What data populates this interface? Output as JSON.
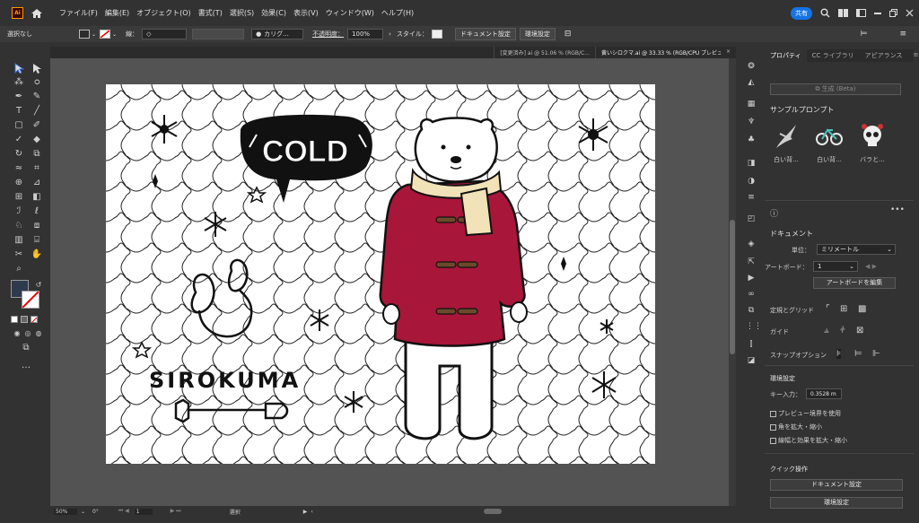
{
  "menubar": {
    "logo": "Ai",
    "items": [
      "ファイル(F)",
      "編集(E)",
      "オブジェクト(O)",
      "書式(T)",
      "選択(S)",
      "効果(C)",
      "表示(V)",
      "ウィンドウ(W)",
      "ヘルプ(H)"
    ],
    "share_label": "共有"
  },
  "controlbar": {
    "selection": "選択なし",
    "stroke_label": "線：",
    "brush_label": "カリグ...",
    "opacity_label": "不透明度：",
    "opacity_value": "100%",
    "style_label": "スタイル：",
    "doc_settings": "ドキュメント設定",
    "prefs": "環境設定"
  },
  "doctabs": [
    "[変更済み] ai @ 51.06 % (RGB/C...",
    "黄いシロクマ.ai @ 33.33 % (RGB/CPU プレビュー..."
  ],
  "artwork": {
    "speech_text": "COLD",
    "title_text": "SIROKUMA"
  },
  "statusbar": {
    "zoom": "50%",
    "rotation": "0°",
    "artboard_num": "1",
    "tool_name": "選択"
  },
  "panel": {
    "tabs": [
      "プロパティ",
      "CC ライブラリ",
      "アピアランス"
    ],
    "generate_button": "生成 (Beta)",
    "sample_prompts_title": "サンプルプロンプト",
    "prompts": [
      {
        "label": "白い背...",
        "icon": "bird-icon"
      },
      {
        "label": "白い背...",
        "icon": "bicycle-icon"
      },
      {
        "label": "バラと...",
        "icon": "skull-icon"
      }
    ],
    "document_title": "ドキュメント",
    "unit_label": "単位：",
    "unit_value": "ミリメートル",
    "artboard_label": "アートボード：",
    "artboard_value": "1",
    "edit_artboards": "アートボードを編集",
    "rulers_grids": "定規とグリッド",
    "guides": "ガイド",
    "snap_options": "スナップオプション",
    "prefs_title": "環境設定",
    "key_input_label": "キー入力：",
    "key_input_value": "0.3528 m",
    "checkboxes": [
      "プレビュー境界を使用",
      "角を拡大・縮小",
      "線幅と効果を拡大・縮小"
    ],
    "quick_actions_title": "クイック操作",
    "quick_doc_settings": "ドキュメント設定",
    "quick_prefs": "環境設定"
  },
  "colors": {
    "accent": "#1473e6",
    "coat": "#a8163a",
    "scarf": "#f2e2b8",
    "canvas_bg": "#535353"
  }
}
